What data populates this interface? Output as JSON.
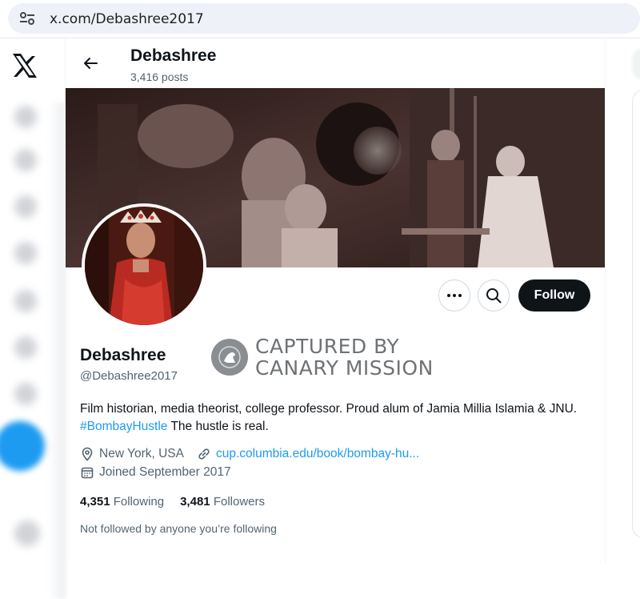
{
  "browser": {
    "url": "x.com/Debashree2017"
  },
  "profile": {
    "name": "Debashree",
    "post_count": "3,416 posts",
    "handle": "@Debashree2017",
    "bio_text": "Film historian, media theorist, college professor. Proud alum of Jamia Millia Islamia & JNU. ",
    "bio_hashtag": "#BombayHustle",
    "bio_tail": " The hustle is real.",
    "location": "New York, USA",
    "website": "cup.columbia.edu/book/bombay-hu...",
    "joined": "Joined September 2017",
    "following_count": "4,351",
    "following_label": "Following",
    "followers_count": "3,481",
    "followers_label": "Followers",
    "not_followed_text": "Not followed by anyone you’re following"
  },
  "actions": {
    "follow_label": "Follow"
  },
  "watermark": {
    "line1": "CAPTURED BY",
    "line2": "CANARY MISSION"
  },
  "icons": [
    "tune-icon",
    "x-logo-icon",
    "back-arrow-icon",
    "more-icon",
    "search-icon",
    "location-icon",
    "link-icon",
    "calendar-icon",
    "canary-bird-icon"
  ],
  "colors": {
    "accent": "#1d9bf0",
    "text": "#0f1419",
    "secondary": "#536471",
    "follow_bg": "#0f1419"
  }
}
